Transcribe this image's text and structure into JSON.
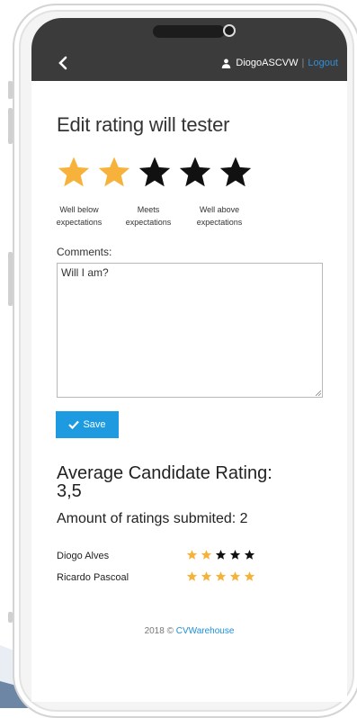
{
  "header": {
    "back_icon": "chevron-left-icon",
    "user_icon": "user-icon",
    "username": "DiogoASCVW",
    "separator": "|",
    "logout_label": "Logout"
  },
  "page": {
    "title": "Edit rating will tester"
  },
  "rating": {
    "value": 2,
    "max": 5,
    "filled_color": "#f7b23b",
    "empty_color": "#111111",
    "labels": {
      "low_line1": "Well below",
      "low_line2": "expectations",
      "mid_line1": "Meets",
      "mid_line2": "expectations",
      "high_line1": "Well above",
      "high_line2": "expectations"
    }
  },
  "comments": {
    "label": "Comments:",
    "value": "Will I am?"
  },
  "save": {
    "label": "Save",
    "color": "#1e9be0"
  },
  "stats": {
    "average_label": "Average Candidate Rating:",
    "average_value": "3,5",
    "amount_label": "Amount of ratings submited: 2"
  },
  "ratings_list": [
    {
      "name": "Diogo Alves",
      "stars": 2
    },
    {
      "name": "Ricardo Pascoal",
      "stars": 5
    }
  ],
  "footer": {
    "copyright": "2018 ©",
    "link": "CVWarehouse"
  }
}
